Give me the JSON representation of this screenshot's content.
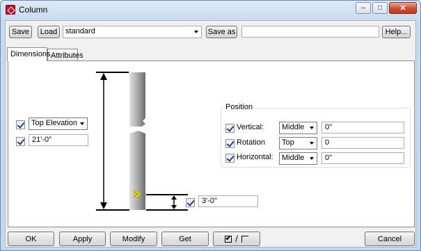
{
  "window": {
    "title": "Column",
    "controls": {
      "minimize": "–",
      "maximize": "□",
      "close": "✕"
    }
  },
  "toolbar": {
    "save_label": "Save",
    "load_label": "Load",
    "preset_value": "standard",
    "save_as_label": "Save as",
    "save_as_value": "",
    "help_label": "Help..."
  },
  "tabs": [
    {
      "label": "Dimensions",
      "active": true
    },
    {
      "label": "Attributes",
      "active": false
    }
  ],
  "dimensions": {
    "elevation_select": "Top Elevation",
    "elevation_value": "21'-0\"",
    "base_offset_value": "3'-0\""
  },
  "position": {
    "group_label": "Position",
    "rows": [
      {
        "label": "Vertical:",
        "select": "Middle",
        "value": "0\""
      },
      {
        "label": "Rotation",
        "select": "Top",
        "value": "0"
      },
      {
        "label": "Horizontal:",
        "select": "Middle",
        "value": "0\""
      }
    ]
  },
  "footer": {
    "ok_label": "OK",
    "apply_label": "Apply",
    "modify_label": "Modify",
    "get_label": "Get",
    "toggle_label": "/",
    "cancel_label": "Cancel"
  }
}
